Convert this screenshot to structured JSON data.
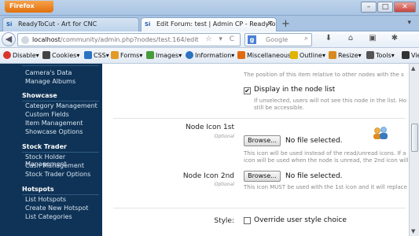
{
  "browser": {
    "menu_button": "Firefox",
    "window_controls": [
      "–",
      "□",
      "✕"
    ],
    "tabs": [
      {
        "favicon": "Si",
        "title": "ReadyToCut - Art for CNC",
        "active": false
      },
      {
        "favicon": "Si",
        "title": "Edit Forum: test | Admin CP - ReadyToCut ...",
        "active": true
      }
    ],
    "new_tab": "+",
    "tab_list": "▾"
  },
  "navbar": {
    "back": "◀",
    "url_host": "localhost",
    "url_path": "/community/admin.php?nodes/test.164/edit",
    "url_icons": "☆ ▾ C",
    "search_engine": "g",
    "search_placeholder": "Google",
    "search_icon": "🔍"
  },
  "devbar": {
    "items": [
      {
        "label": "Disable▾",
        "color": "#d9342b"
      },
      {
        "label": "Cookies▾",
        "color": "#444444"
      },
      {
        "label": "CSS▾",
        "color": "#2b72c2"
      },
      {
        "label": "Forms▾",
        "color": "#e29a26"
      },
      {
        "label": "Images▾",
        "color": "#4a9b3c"
      },
      {
        "label": "Information▾",
        "color": "#2b72c2"
      },
      {
        "label": "Miscellaneous▾",
        "color": "#e06a12"
      },
      {
        "label": "Outline▾",
        "color": "#e0b400"
      },
      {
        "label": "Resize▾",
        "color": "#d88a1f"
      },
      {
        "label": "Tools▾",
        "color": "#555555"
      },
      {
        "label": "Vie",
        "color": "#333333"
      }
    ]
  },
  "sidebar": {
    "top_items": [
      "Camera's Data",
      "Manage Albums"
    ],
    "sections": [
      {
        "heading": "Showcase",
        "items": [
          "Category Management",
          "Custom Fields",
          "Item Management",
          "Showcase Options"
        ]
      },
      {
        "heading": "Stock Trader",
        "items": [
          "Stock Holder Management",
          "Cash Management",
          "Stock Trader Options"
        ]
      },
      {
        "heading": "Hotspots",
        "items": [
          "List Hotspots",
          "Create New Hotspot",
          "List Categories"
        ]
      }
    ]
  },
  "form": {
    "position_hint": "The position of this item relative to other nodes with the s",
    "display_in_list": {
      "checked": true,
      "label": "Display in the node list",
      "hint_line1": "If unselected, users will not see this node in the list. Ho",
      "hint_line2": "still be accessible."
    },
    "node_icon_1st": {
      "label": "Node Icon 1st",
      "optional": "Optional",
      "button": "Browse...",
      "file_status": "No file selected.",
      "hint_line1": "This icon will be used instead of the read/unread icons. If a",
      "hint_line2": "icon will be used when the node is unread, the 2nd icon will"
    },
    "node_icon_2nd": {
      "label": "Node Icon 2nd",
      "optional": "Optional",
      "button": "Browse...",
      "file_status": "No file selected.",
      "hint_line1": "This icon MUST be used with the 1st icon and it will replace"
    },
    "style": {
      "label": "Style:",
      "checked": false,
      "option": "Override user style choice"
    }
  }
}
